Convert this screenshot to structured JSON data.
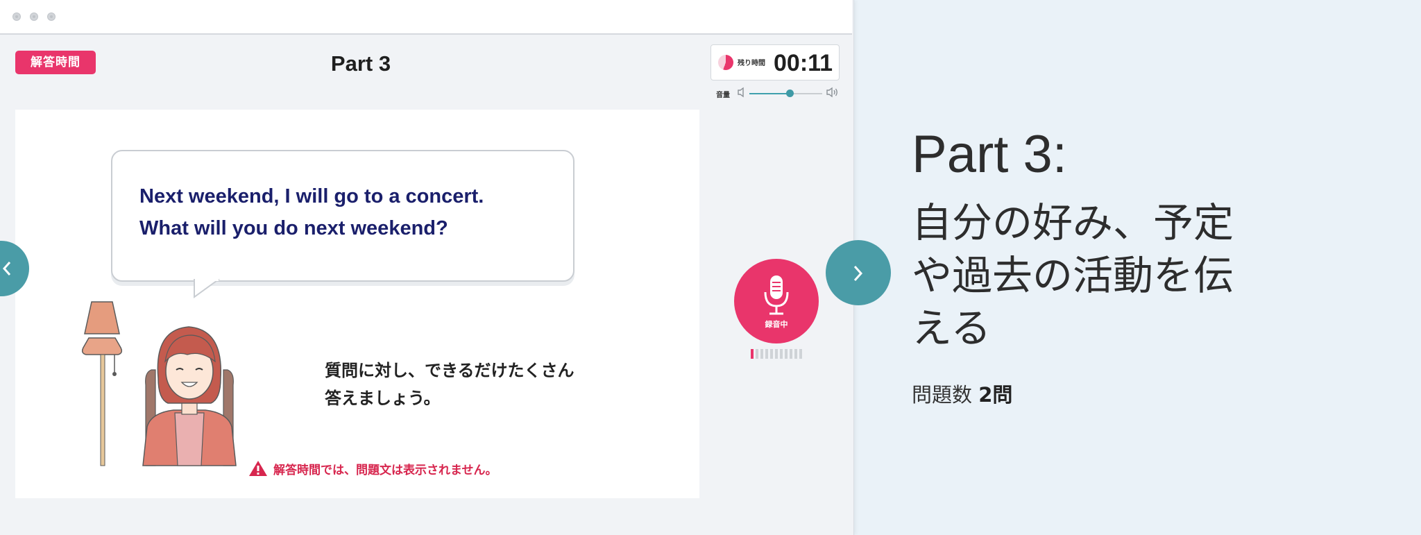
{
  "app": {
    "badge": "解答時間",
    "title": "Part 3",
    "timer": {
      "label": "残り時間",
      "value": "00:11"
    },
    "volume": {
      "label": "音量",
      "level": 0.55
    }
  },
  "question": {
    "prompt_lines": [
      "Next weekend, I will go to a concert.",
      "What will you do next weekend?"
    ],
    "instruction_lines": [
      "質問に対し、できるだけたくさん",
      "答えましょう。"
    ],
    "warning": "解答時間では、問題文は表示されません。"
  },
  "recorder": {
    "label": "録音中",
    "level_segments": 11,
    "level_active": 1
  },
  "info_panel": {
    "heading": "Part 3:",
    "subtitle_lines": [
      "自分の好み、予定",
      "や過去の活動を伝",
      "える"
    ],
    "count_label": "問題数",
    "count_value": "2問"
  },
  "colors": {
    "accent": "#e9356b",
    "teal": "#4a9ca7",
    "prompt_text": "#1a1f6b",
    "background": "#eaf2f8"
  },
  "icons": {
    "mic": "microphone-icon",
    "prev": "chevron-left-icon",
    "next": "chevron-right-icon",
    "warning": "warning-triangle-icon",
    "volume_low": "speaker-low-icon",
    "volume_high": "speaker-high-icon"
  }
}
